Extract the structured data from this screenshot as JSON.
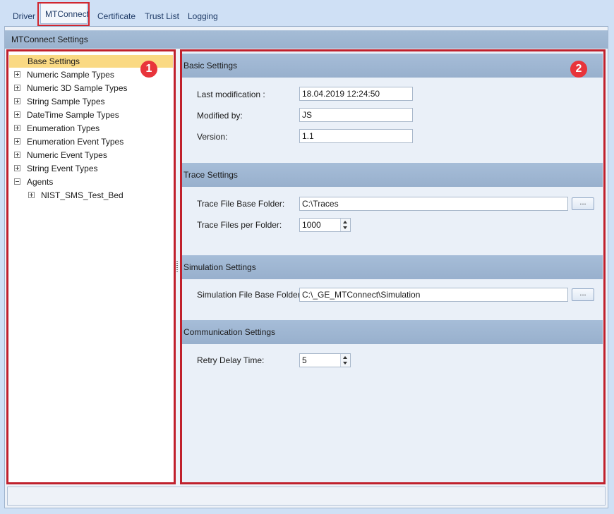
{
  "tabs": [
    {
      "label": "Driver"
    },
    {
      "label": "MTConnect",
      "active": true
    },
    {
      "label": "Certificate"
    },
    {
      "label": "Trust List"
    },
    {
      "label": "Logging"
    }
  ],
  "panel_title": "MTConnect Settings",
  "tree": {
    "items": [
      {
        "label": "Base Settings",
        "selected": true
      },
      {
        "label": "Numeric Sample Types",
        "expander": "plus"
      },
      {
        "label": "Numeric 3D Sample Types",
        "expander": "plus"
      },
      {
        "label": "String Sample Types",
        "expander": "plus"
      },
      {
        "label": "DateTime Sample Types",
        "expander": "plus"
      },
      {
        "label": "Enumeration Types",
        "expander": "plus"
      },
      {
        "label": "Enumeration Event Types",
        "expander": "plus"
      },
      {
        "label": "Numeric Event Types",
        "expander": "plus"
      },
      {
        "label": "String Event Types",
        "expander": "plus"
      },
      {
        "label": "Agents",
        "expander": "minus"
      },
      {
        "label": "NIST_SMS_Test_Bed",
        "expander": "plus",
        "indent": 1
      }
    ]
  },
  "badges": {
    "one": "1",
    "two": "2"
  },
  "sections": {
    "basic": {
      "title": "Basic Settings",
      "last_modification_label": "Last modification :",
      "last_modification_value": "18.04.2019 12:24:50",
      "modified_by_label": "Modified by:",
      "modified_by_value": "JS",
      "version_label": "Version:",
      "version_value": "1.1"
    },
    "trace": {
      "title": "Trace Settings",
      "base_folder_label": "Trace File Base Folder:",
      "base_folder_value": "C:\\Traces",
      "browse_label": "...",
      "files_per_folder_label": "Trace Files per Folder:",
      "files_per_folder_value": "1000"
    },
    "simulation": {
      "title": "Simulation Settings",
      "base_folder_label": "Simulation File Base Folder:",
      "base_folder_value": "C:\\_GE_MTConnect\\Simulation",
      "browse_label": "..."
    },
    "communication": {
      "title": "Communication Settings",
      "retry_delay_label": "Retry Delay Time:",
      "retry_delay_value": "5"
    }
  },
  "colors": {
    "highlight_red": "#d0262f",
    "selected_item": "#fad983",
    "section_header": "#9ab2ce",
    "badge": "#e8343b"
  }
}
